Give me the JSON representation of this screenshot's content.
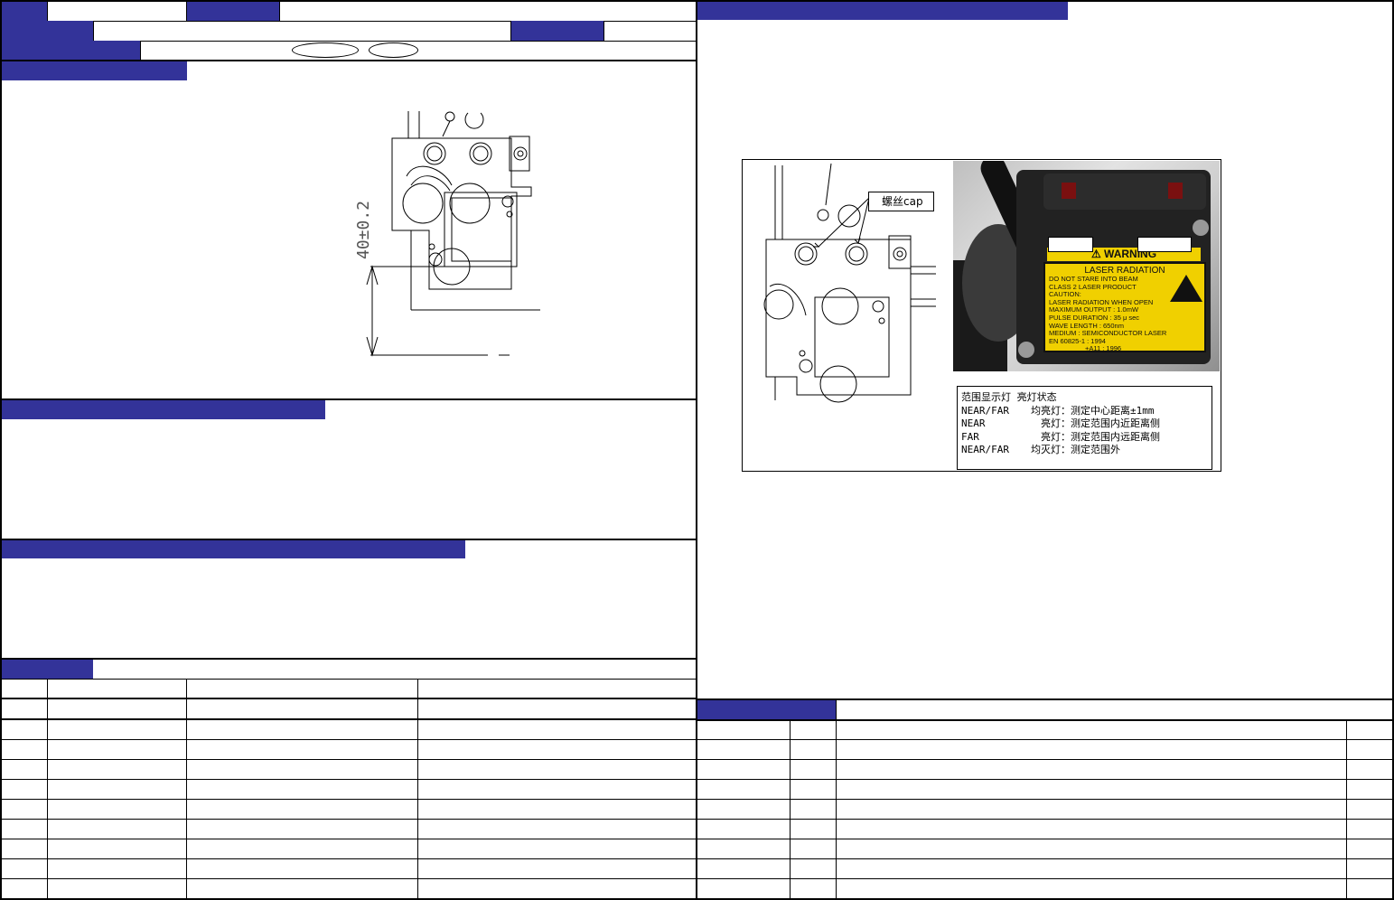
{
  "photo": {
    "callout": "螺丝cap",
    "label_text": {
      "line1": "LASER RADIATION",
      "line2": "DO NOT STARE INTO BEAM",
      "line3": "CLASS 2 LASER PRODUCT",
      "line4": "CAUTION:",
      "line5": "LASER RADIATION WHEN OPEN",
      "line6": "MAXIMUM OUTPUT : 1.0mW",
      "line7": "PULSE DURATION  : 35 μ sec",
      "line8": "WAVE LENGTH      : 650nm",
      "line9": "MEDIUM : SEMICONDUCTOR LASER",
      "line10": "EN 60825-1 : 1994",
      "line11": "+A11 : 1996"
    },
    "warning": "WARNING"
  },
  "legend": {
    "title": "范围显示灯 亮灯状态",
    "rows": [
      {
        "name": "NEAR/FAR",
        "state": "均亮灯",
        "desc": "：测定中心距离±1mm"
      },
      {
        "name": "NEAR",
        "state": "亮灯",
        "desc": "：测定范围内近距离侧"
      },
      {
        "name": "FAR",
        "state": "亮灯",
        "desc": "：测定范围内远距离侧"
      },
      {
        "name": "NEAR/FAR",
        "state": "均灭灯",
        "desc": "：测定范围外"
      }
    ]
  },
  "drawing": {
    "dimension": "40±0.2"
  }
}
